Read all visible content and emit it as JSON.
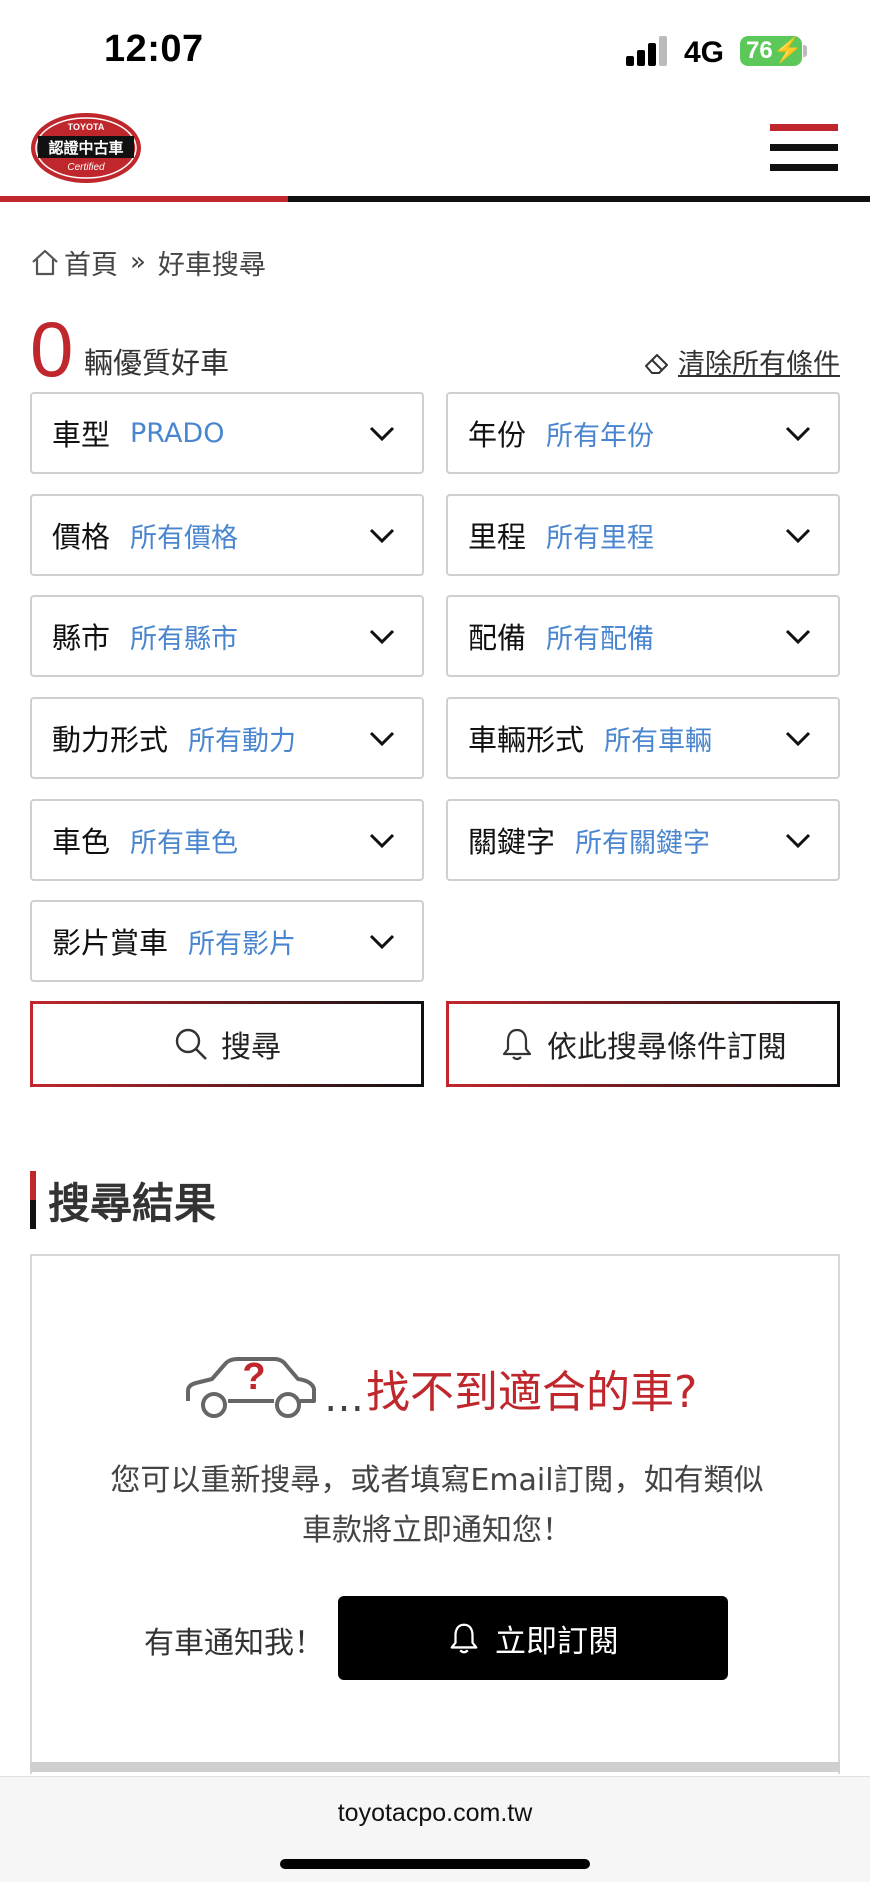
{
  "status_bar": {
    "time": "12:07",
    "network": "4G",
    "battery": "76"
  },
  "logo": {
    "brand": "TOYOTA",
    "title": "認證中古車",
    "sub": "Certified"
  },
  "breadcrumb": {
    "home": "首頁",
    "separator": "»",
    "current": "好車搜尋"
  },
  "count": {
    "number": "0",
    "label": "輛優質好車",
    "clear_label": "清除所有條件"
  },
  "filters": [
    {
      "label": "車型",
      "value": "PRADO"
    },
    {
      "label": "年份",
      "value": "所有年份"
    },
    {
      "label": "價格",
      "value": "所有價格"
    },
    {
      "label": "里程",
      "value": "所有里程"
    },
    {
      "label": "縣市",
      "value": "所有縣市"
    },
    {
      "label": "配備",
      "value": "所有配備"
    },
    {
      "label": "動力形式",
      "value": "所有動力"
    },
    {
      "label": "車輛形式",
      "value": "所有車輛"
    },
    {
      "label": "車色",
      "value": "所有車色"
    },
    {
      "label": "關鍵字",
      "value": "所有關鍵字"
    },
    {
      "label": "影片賞車",
      "value": "所有影片"
    }
  ],
  "buttons": {
    "search": "搜尋",
    "subscribe_search": "依此搜尋條件訂閱"
  },
  "results": {
    "title": "搜尋結果",
    "dots": "…",
    "no_car": "找不到適合的車?",
    "desc_line1": "您可以重新搜尋，或者填寫Email訂閱，如有類似",
    "desc_line2": "車款將立即通知您！",
    "notify_label": "有車通知我！",
    "subscribe_now": "立即訂閱"
  },
  "browser": {
    "url": "toyotacpo.com.tw"
  },
  "colors": {
    "brand_red": "#c0272d",
    "link_blue": "#4a86d0",
    "black": "#111111"
  }
}
